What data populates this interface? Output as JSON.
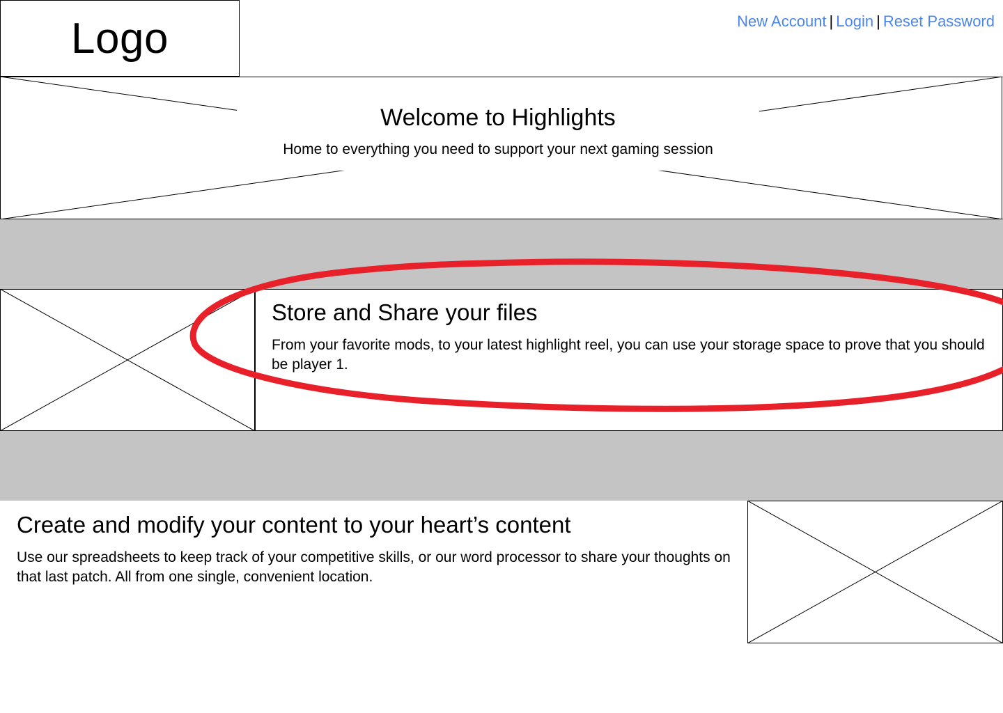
{
  "header": {
    "logo_text": "Logo",
    "links": {
      "new_account": "New Account",
      "separator_1": "|",
      "login": "Login",
      "separator_2": "|",
      "reset_password": "Reset Password"
    }
  },
  "hero": {
    "title": "Welcome to Highlights",
    "subtitle": "Home to everything you need to support your next gaming session"
  },
  "features": [
    {
      "title": "Store and Share your files",
      "body": "From your favorite mods, to your latest highlight reel, you can use your storage space to prove that you should be player 1."
    },
    {
      "title": "Create and modify your content to your heart’s content",
      "body": "Use our spreadsheets to keep track of your competitive skills, or our word processor to share your thoughts on that last patch. All from one single, convenient location."
    }
  ],
  "colors": {
    "link": "#4a86e8",
    "band": "#c4c4c4",
    "annotation": "#e8202a"
  }
}
